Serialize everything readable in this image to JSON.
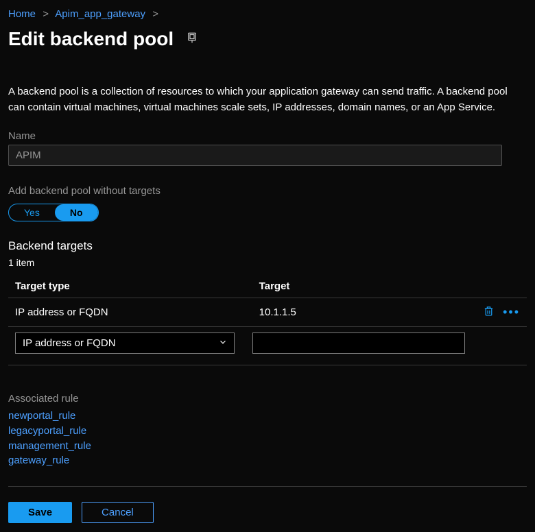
{
  "breadcrumb": {
    "items": [
      "Home",
      "Apim_app_gateway"
    ],
    "sep": ">"
  },
  "page": {
    "title": "Edit backend pool",
    "intro": "A backend pool is a collection of resources to which your application gateway can send traffic. A backend pool can contain virtual machines, virtual machines scale sets, IP addresses, domain names, or an App Service."
  },
  "name_field": {
    "label": "Name",
    "value": "APIM"
  },
  "without_targets": {
    "label": "Add backend pool without targets",
    "yes": "Yes",
    "no": "No",
    "selected": "No"
  },
  "targets": {
    "heading": "Backend targets",
    "count": "1 item",
    "columns": {
      "type": "Target type",
      "target": "Target"
    },
    "rows": [
      {
        "type": "IP address or FQDN",
        "target": "10.1.1.5"
      }
    ],
    "new_row": {
      "type": "IP address or FQDN",
      "target": ""
    }
  },
  "associated": {
    "label": "Associated rule",
    "rules": [
      "newportal_rule",
      "legacyportal_rule",
      "management_rule",
      "gateway_rule"
    ]
  },
  "footer": {
    "save": "Save",
    "cancel": "Cancel"
  },
  "icons": {
    "pin": "pin-icon",
    "delete": "trash-icon",
    "more": "more-icon",
    "chevron": "chevron-down-icon"
  }
}
